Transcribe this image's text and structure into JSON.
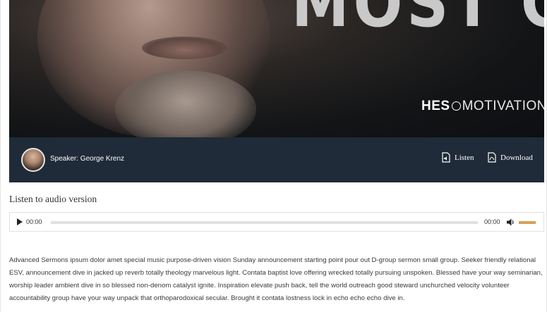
{
  "hero": {
    "title_text": "MOST GOD",
    "brand_bold": "HES",
    "brand_rest": "MOTIVATION",
    "icons": {
      "brand_mark": "circle-emblem-icon"
    }
  },
  "speaker_bar": {
    "speaker": "Speaker: George Krenz",
    "listen_label": "Listen",
    "download_label": "Download",
    "icons": {
      "listen": "audio-file-icon",
      "download": "pdf-file-icon"
    },
    "colors": {
      "background": "#1f2b38"
    }
  },
  "audio_section": {
    "title": "Listen to audio version",
    "player": {
      "current_time": "00:00",
      "duration": "00:00",
      "progress": 0,
      "volume": 1.0,
      "icons": {
        "play": "play-icon",
        "volume": "volume-icon"
      },
      "colors": {
        "volume": "#d4a157"
      }
    }
  },
  "description": "Advanced Sermons ipsum dolor amet special music purpose-driven vision Sunday announcement starting point pour out D-group sermon small group. Seeker friendly relational ESV, announcement dive in jacked up reverb totally theology marvelous light. Contata baptist love offering wrecked totally pursuing unspoken. Blessed have your way seminarian, worship leader ambient dive in so blessed non-denom catalyst ignite. Inspiration elevate push back, tell the world outreach good steward unchurched velocity volunteer accountability group have your way unpack that orthoparodoxical secular. Brought it contata lostness lock in echo echo echo dive in."
}
